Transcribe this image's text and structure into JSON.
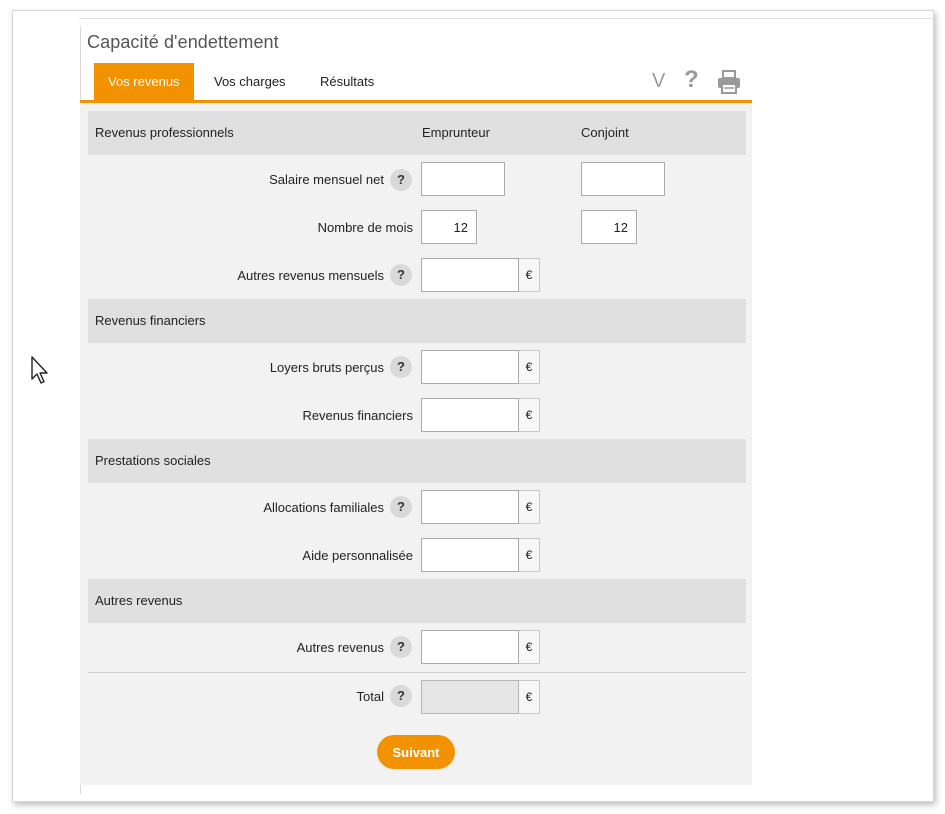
{
  "title": "Capacité d'endettement",
  "tabs": [
    {
      "label": "Vos revenus",
      "active": true
    },
    {
      "label": "Vos charges",
      "active": false
    },
    {
      "label": "Résultats",
      "active": false
    }
  ],
  "tools": {
    "collapse_glyph": "V",
    "help_glyph": "?"
  },
  "columns": {
    "borrower": "Emprunteur",
    "spouse": "Conjoint"
  },
  "sections": {
    "professional": {
      "title": "Revenus professionnels",
      "salary_label": "Salaire mensuel net",
      "salary_borrower": "",
      "salary_spouse": "",
      "months_label": "Nombre de mois",
      "months_borrower": "12",
      "months_spouse": "12",
      "other_label": "Autres revenus mensuels",
      "other_value": ""
    },
    "financial": {
      "title": "Revenus financiers",
      "rent_label": "Loyers bruts perçus",
      "rent_value": "",
      "fin_label": "Revenus financiers",
      "fin_value": ""
    },
    "social": {
      "title": "Prestations sociales",
      "family_label": "Allocations familiales",
      "family_value": "",
      "aid_label": "Aide personnalisée",
      "aid_value": ""
    },
    "other": {
      "title": "Autres revenus",
      "other_label": "Autres revenus",
      "other_value": ""
    }
  },
  "total": {
    "label": "Total",
    "value": ""
  },
  "currency": "€",
  "help_mark": "?",
  "next_button": "Suivant",
  "colors": {
    "accent": "#f39200",
    "section_bg": "#e0e0e0",
    "content_bg": "#f2f2f2"
  }
}
